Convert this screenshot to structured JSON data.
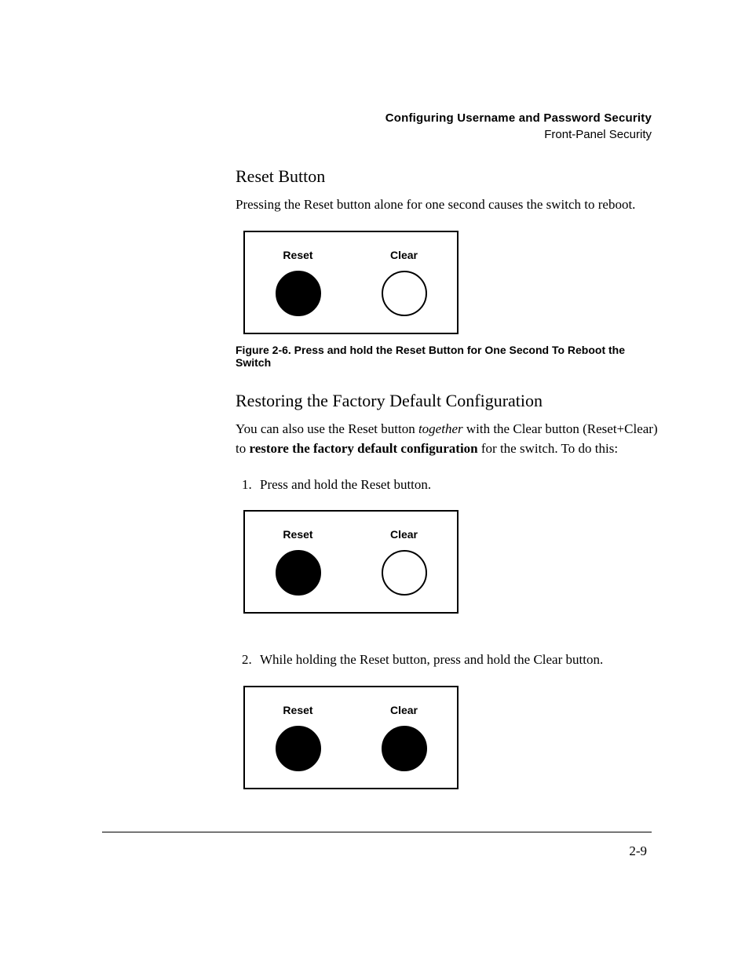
{
  "header": {
    "chapter": "Configuring Username and Password Security",
    "section": "Front-Panel Security"
  },
  "s1": {
    "heading": "Reset Button",
    "para": "Pressing the Reset button alone for one second causes the switch to reboot."
  },
  "panel_labels": {
    "reset": "Reset",
    "clear": "Clear"
  },
  "fig_caption": "Figure 2-6.    Press and hold the Reset Button for One Second To Reboot the Switch",
  "s2": {
    "heading": "Restoring the Factory Default Configuration",
    "para_pre": "You can also use the Reset button ",
    "para_it": "together",
    "para_mid": " with the Clear button (Reset+Clear) to ",
    "para_bd": "restore the factory default configuration",
    "para_post": " for the switch. To do this:"
  },
  "steps": {
    "s1": "Press and hold the Reset button.",
    "s2": "While holding the Reset button, press and hold the Clear button."
  },
  "page_number": "2-9"
}
